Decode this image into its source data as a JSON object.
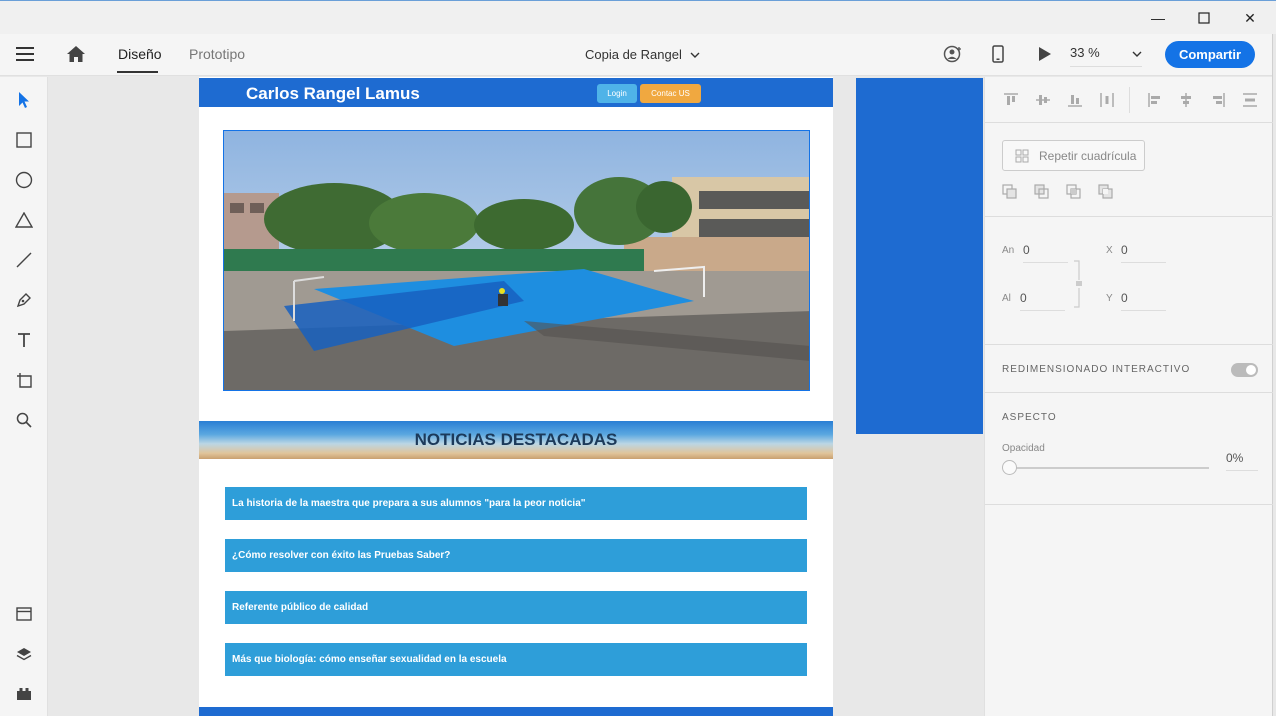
{
  "window": {
    "minimize_glyph": "—",
    "maximize_glyph": "☐",
    "close_glyph": "✕"
  },
  "appbar": {
    "tabs": [
      {
        "label": "Diseño",
        "active": true
      },
      {
        "label": "Prototipo",
        "active": false
      }
    ],
    "doc_title": "Copia de Rangel",
    "zoom": "33 %",
    "share_label": "Compartir",
    "accent": "#1473e6"
  },
  "artboard": {
    "site_title": "Carlos Rangel Lamus",
    "login_label": "Login",
    "contact_label": "Contac US",
    "news_heading": "NOTICIAS DESTACADAS",
    "news_items": [
      "La historia de la maestra que prepara a sus alumnos \"para la peor noticia\"",
      "¿Cómo resolver con éxito las Pruebas Saber?",
      "Referente público de calidad",
      "Más que biología: cómo enseñar sexualidad en la escuela"
    ],
    "header_color": "#1e6bd1",
    "news_item_color": "#2e9ed9"
  },
  "panel": {
    "repeat_grid_label": "Repetir cuadrícula",
    "width_label": "An",
    "width_value": "0",
    "height_label": "Al",
    "height_value": "0",
    "x_label": "X",
    "x_value": "0",
    "y_label": "Y",
    "y_value": "0",
    "responsive_label": "REDIMENSIONADO INTERACTIVO",
    "appearance_label": "ASPECTO",
    "opacity_label": "Opacidad",
    "opacity_value": "0%"
  }
}
